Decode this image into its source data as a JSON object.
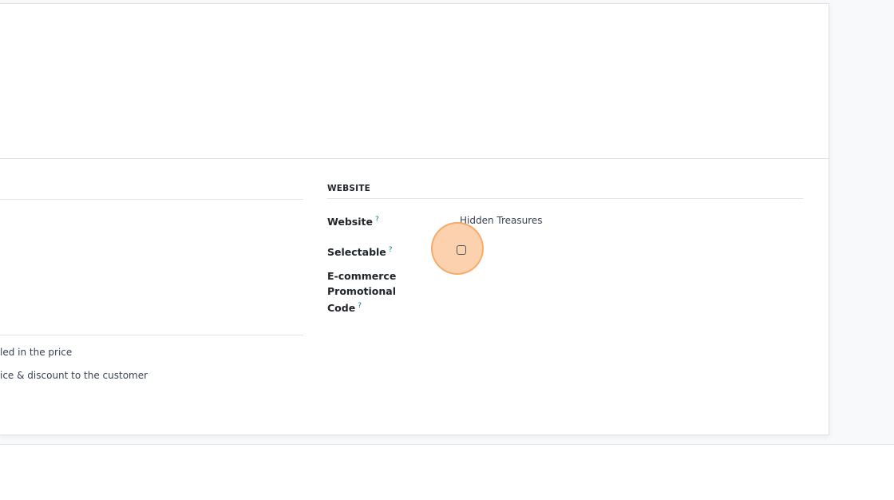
{
  "left_panel": {
    "line1": "led in the price",
    "line2": "ice & discount to the customer"
  },
  "website_group": {
    "title": "WEBSITE",
    "help_marker": "?",
    "fields": {
      "website": {
        "label": "Website",
        "value": "Hidden Treasures"
      },
      "selectable": {
        "label": "Selectable",
        "checked": false
      },
      "ecommerce_code": {
        "label_line1": "E-commerce Promotional",
        "label_line2": "Code",
        "value": ""
      }
    }
  },
  "colors": {
    "help_marker": "#017e84",
    "highlight_fill": "#fbba82",
    "highlight_border": "#f6a662"
  }
}
